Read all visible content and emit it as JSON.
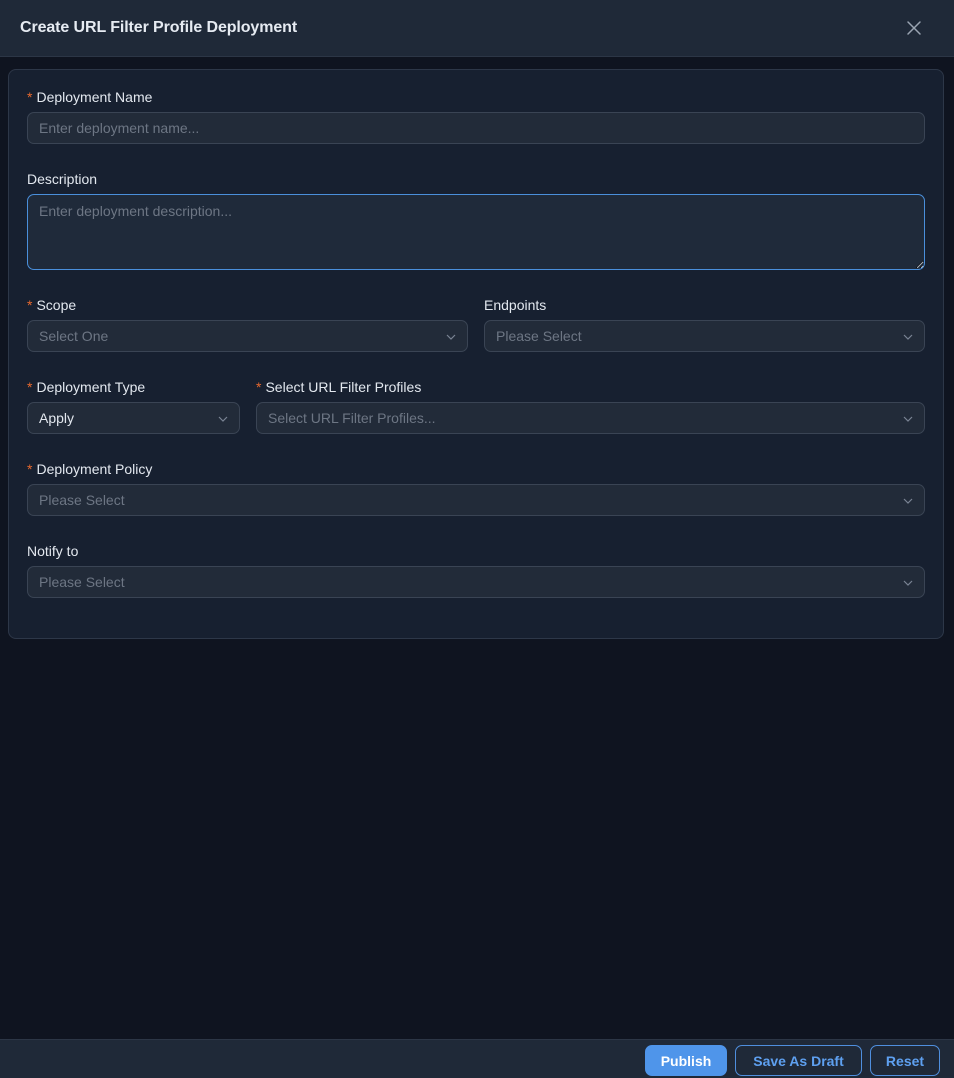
{
  "header": {
    "title": "Create URL Filter Profile Deployment",
    "close_icon": "close-icon"
  },
  "form": {
    "required_marker": "*",
    "deployment_name": {
      "label": "Deployment Name",
      "placeholder": "Enter deployment name..."
    },
    "description": {
      "label": "Description",
      "placeholder": "Enter deployment description..."
    },
    "scope": {
      "label": "Scope",
      "placeholder": "Select One"
    },
    "endpoints": {
      "label": "Endpoints",
      "placeholder": "Please Select"
    },
    "deployment_type": {
      "label": "Deployment Type",
      "value": "Apply"
    },
    "url_filter_profiles": {
      "label": "Select URL Filter Profiles",
      "placeholder": "Select URL Filter Profiles..."
    },
    "deployment_policy": {
      "label": "Deployment Policy",
      "placeholder": "Please Select"
    },
    "notify_to": {
      "label": "Notify to",
      "placeholder": "Please Select"
    }
  },
  "footer": {
    "publish_label": "Publish",
    "save_draft_label": "Save As Draft",
    "reset_label": "Reset"
  },
  "colors": {
    "accent": "#4f95ea",
    "required": "#e8692e",
    "background": "#0f1420",
    "panel": "#172030"
  }
}
